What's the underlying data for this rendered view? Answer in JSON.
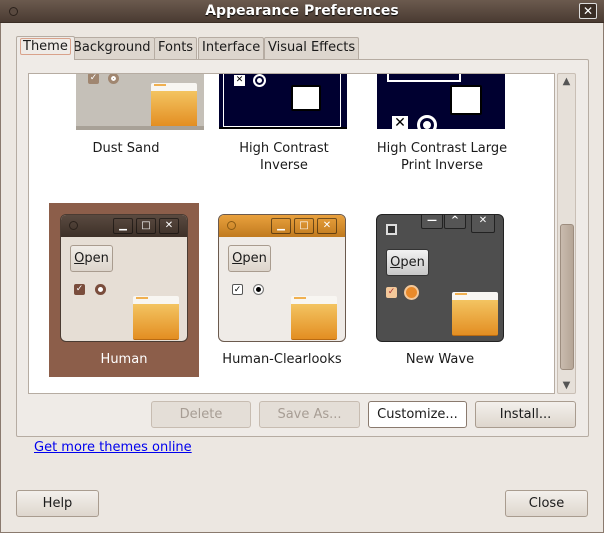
{
  "window": {
    "title": "Appearance Preferences",
    "close_icon": "close-icon"
  },
  "tabs": [
    {
      "label": "Theme",
      "active": true
    },
    {
      "label": "Background"
    },
    {
      "label": "Fonts"
    },
    {
      "label": "Interface"
    },
    {
      "label": "Visual Effects"
    }
  ],
  "themes": [
    {
      "name": "Dust Sand"
    },
    {
      "name": "High Contrast Inverse",
      "line1": "High Contrast",
      "line2": "Inverse"
    },
    {
      "name": "High Contrast Large Print Inverse",
      "line1": "High Contrast Large",
      "line2": "Print Inverse"
    },
    {
      "name": "Human",
      "selected": true
    },
    {
      "name": "Human-Clearlooks"
    },
    {
      "name": "New Wave"
    }
  ],
  "preview": {
    "open_label": "Open",
    "open_rest": "pen",
    "open_mnemonic": "O"
  },
  "actions": {
    "delete": "Delete",
    "save_as": "Save As...",
    "customize": "Customize...",
    "install": "Install..."
  },
  "link": "Get more themes online",
  "footer": {
    "help": "Help",
    "close": "Close"
  },
  "colors": {
    "selection": "#8c5e4a",
    "titlebar": "#4a3b32",
    "link": "#0000ee"
  }
}
